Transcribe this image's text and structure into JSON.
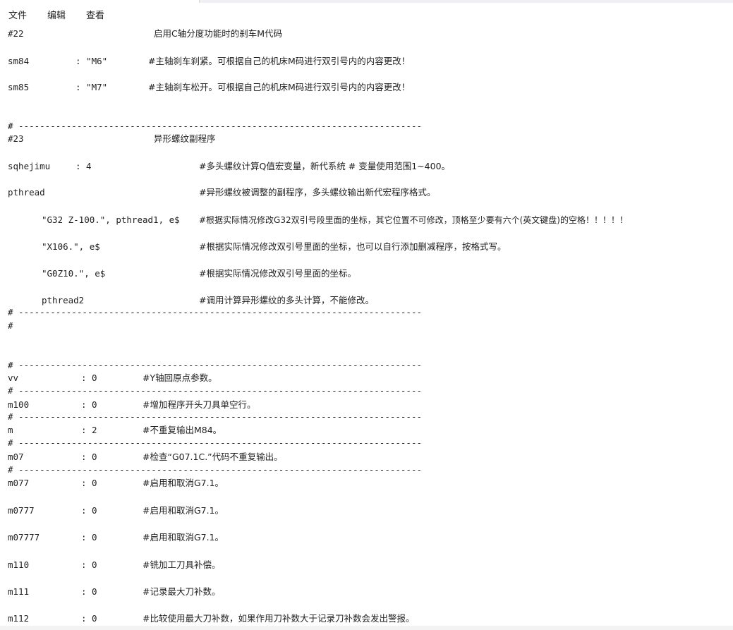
{
  "menu": {
    "file": "文件",
    "edit": "编辑",
    "view": "查看"
  },
  "separator": "# ----------------------------------------------------------------------------",
  "lines": [
    {
      "a": "#22",
      "c": "启用C轴分度功能时的刹车M代码"
    },
    {
      "a": "sm84",
      "b": ": \"M6\"",
      "c": "#主轴刹车刹紧。可根据自己的机床M码进行双引号内的内容更改！"
    },
    {
      "a": "sm85",
      "b": ": \"M7\"",
      "c": "#主轴刹车松开。可根据自己的机床M码进行双引号内的内容更改！"
    },
    {
      "a": "#23",
      "c": "异形螺纹副程序"
    },
    {
      "a": "sqhejimu",
      "b": ": 4",
      "c": "#多头螺纹计算Q值宏变量，新代系统 # 变量使用范围1~400。"
    },
    {
      "a": "pthread",
      "c": "#异形螺纹被调整的副程序，多头螺纹输出新代宏程序格式。"
    },
    {
      "a": "\"G32 Z-100.\", pthread1, e$",
      "c": "#根据实际情况修改G32双引号段里面的坐标，其它位置不可修改，顶格至少要有六个(英文键盘)的空格！！！！！"
    },
    {
      "a": "\"X106.\", e$",
      "c": "#根据实际情况修改双引号里面的坐标，也可以自行添加删减程序，按格式写。"
    },
    {
      "a": "\"G0Z10.\", e$",
      "c": "#根据实际情况修改双引号里面的坐标。"
    },
    {
      "a": "pthread2",
      "c": "#调用计算异形螺纹的多头计算，不能修改。"
    },
    {
      "a": "#"
    },
    {
      "a": "vv",
      "b": ": 0",
      "c": "#Y轴回原点参数。"
    },
    {
      "a": "m100",
      "b": ": 0",
      "c": "#增加程序开头刀具单空行。"
    },
    {
      "a": "m",
      "b": ": 2",
      "c": "#不重复输出M84。"
    },
    {
      "a": "m07",
      "b": ": 0",
      "c": "#检查“G07.1C.”代码不重复输出。"
    },
    {
      "a": "m077",
      "b": ": 0",
      "c": "#启用和取消G7.1。"
    },
    {
      "a": "m0777",
      "b": ": 0",
      "c": "#启用和取消G7.1。"
    },
    {
      "a": "m07777",
      "b": ": 0",
      "c": "#启用和取消G7.1。"
    },
    {
      "a": "m110",
      "b": ": 0",
      "c": "#铣加工刀具补偿。"
    },
    {
      "a": "m111",
      "b": ": 0",
      "c": "#记录最大刀补数。"
    },
    {
      "a": "m112",
      "b": ": 0",
      "c": "#比较使用最大刀补数，如果作用刀补数大于记录刀补数会发出警报。"
    }
  ]
}
